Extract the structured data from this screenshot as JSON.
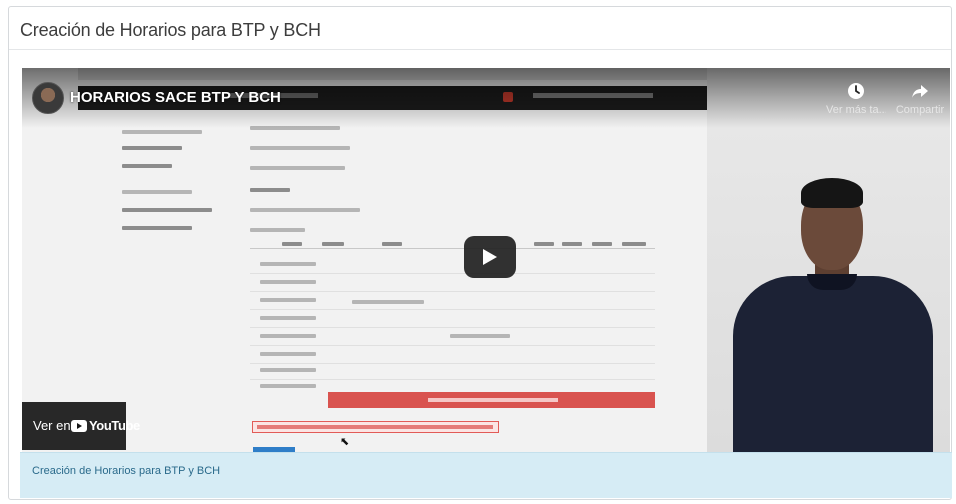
{
  "panel": {
    "title": "Creación de Horarios para BTP y BCH"
  },
  "video": {
    "title": "HORARIOS SACE BTP Y BCH",
    "actions": [
      {
        "label": "Ver más ta...",
        "icon": "clock-icon"
      },
      {
        "label": "Compartir",
        "icon": "share-icon"
      }
    ],
    "watch_on_label": "Ver en",
    "youtube_label": "YouTube"
  },
  "caption": {
    "text": "Creación de Horarios para BTP y BCH"
  },
  "colors": {
    "caption_bg": "#d6ecf5",
    "caption_text": "#2a6a8b",
    "youtube_red": "#ff0000"
  }
}
